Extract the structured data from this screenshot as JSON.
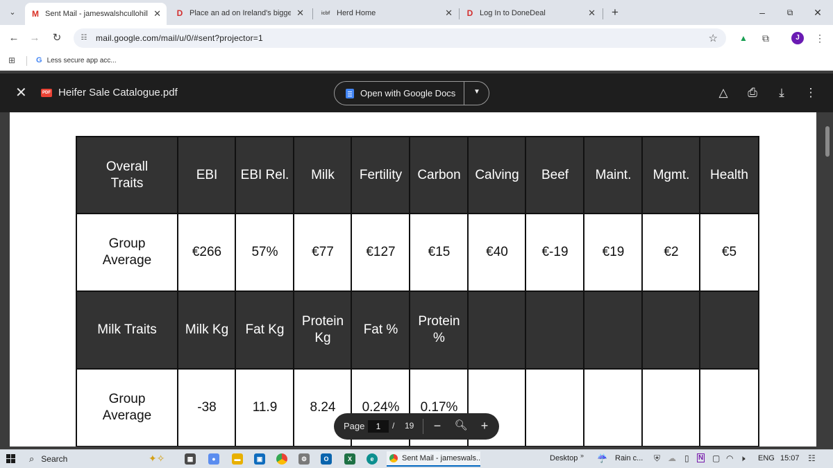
{
  "browser": {
    "tabs": [
      {
        "label": "Sent Mail - jameswalshcullohill",
        "favicon": "gmail-icon",
        "active": true
      },
      {
        "label": "Place an ad on Ireland's biggest",
        "favicon": "donedeal-icon",
        "active": false
      },
      {
        "label": "Herd Home",
        "favicon": "icbf-icon",
        "active": false
      },
      {
        "label": "Log In to DoneDeal",
        "favicon": "donedeal-icon",
        "active": false
      }
    ],
    "favicon_letters": {
      "gmail": "M",
      "donedeal": "D",
      "icbf": "icbf"
    },
    "url": "mail.google.com/mail/u/0/#sent?projector=1",
    "bookmark": {
      "label": "Less secure app acc...",
      "icon_letter": "G"
    },
    "avatar_letter": "J"
  },
  "viewer": {
    "file_badge": "PDF",
    "file_name": "Heifer Sale Catalogue.pdf",
    "open_with_label": "Open with Google Docs"
  },
  "table": {
    "header1": [
      "Overall Traits",
      "EBI",
      "EBI Rel.",
      "Milk",
      "Fertility",
      "Carbon",
      "Calving",
      "Beef",
      "Maint.",
      "Mgmt.",
      "Health"
    ],
    "row1": [
      "Group Average",
      "€266",
      "57%",
      "€77",
      "€127",
      "€15",
      "€40",
      "€-19",
      "€19",
      "€2",
      "€5"
    ],
    "header2": [
      "Milk Traits",
      "Milk Kg",
      "Fat Kg",
      "Protein Kg",
      "Fat %",
      "Protein %",
      "",
      "",
      "",
      "",
      ""
    ],
    "row2": [
      "Group Average",
      "-38",
      "11.9",
      "8.24",
      "0.24%",
      "0.17%",
      "",
      "",
      "",
      "",
      ""
    ]
  },
  "page_controls": {
    "label": "Page",
    "current": "1",
    "separator": "/",
    "total": "19"
  },
  "taskbar": {
    "search_label": "Search",
    "active_app": "Sent Mail - jameswals...",
    "desktop_label": "Desktop",
    "weather": "Rain c...",
    "language": "ENG",
    "time": "15:07"
  },
  "colors": {
    "header_cell": "#333333",
    "viewer_bar": "#1e1e1e",
    "accent_blue": "#0067c0"
  }
}
